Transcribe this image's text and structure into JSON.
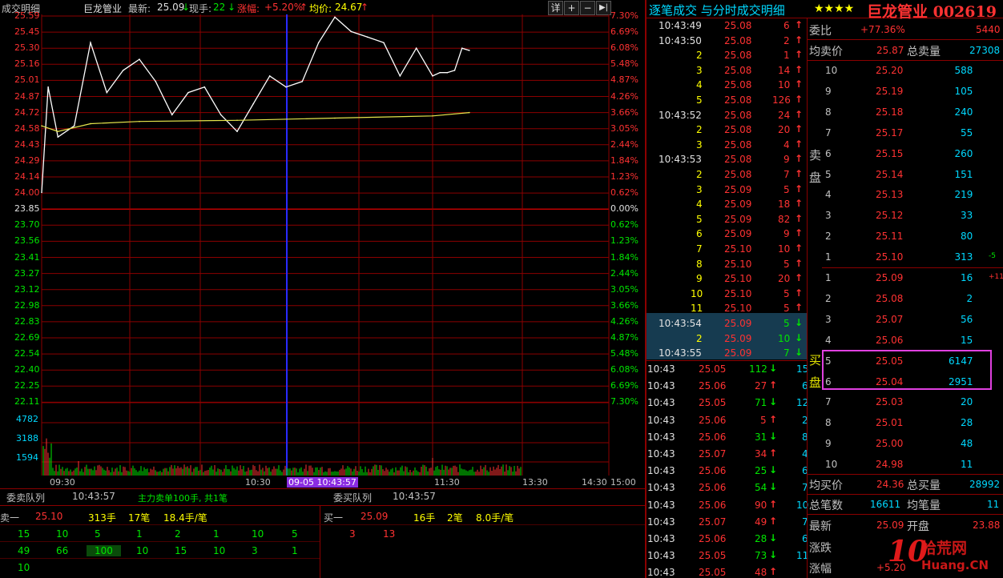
{
  "header": {
    "panel_name": "成交明细",
    "stock_name": "巨龙管业",
    "latest_label": "最新:",
    "latest_value": "25.09",
    "current_hand_label": "现手:",
    "current_hand_value": "22",
    "change_label": "涨幅:",
    "change_value": "+5.20%",
    "avg_label": "均价:",
    "avg_value": "24.67",
    "detail_button": "详",
    "plus_button": "+",
    "minus_button": "−",
    "next_button": "▶|"
  },
  "chart": {
    "left_prices": [
      "25.59",
      "25.45",
      "25.30",
      "25.16",
      "25.01",
      "24.87",
      "24.72",
      "24.58",
      "24.43",
      "24.29",
      "24.14",
      "24.00",
      "23.85",
      "23.70",
      "23.56",
      "23.41",
      "23.27",
      "23.12",
      "22.98",
      "22.83",
      "22.69",
      "22.54",
      "22.40",
      "22.25",
      "22.11"
    ],
    "right_pcts": [
      "7.30%",
      "6.69%",
      "6.08%",
      "5.48%",
      "4.87%",
      "4.26%",
      "3.66%",
      "3.05%",
      "2.44%",
      "1.84%",
      "1.23%",
      "0.62%",
      "0.00%",
      "0.62%",
      "1.23%",
      "1.84%",
      "2.44%",
      "3.05%",
      "3.66%",
      "4.26%",
      "4.87%",
      "5.48%",
      "6.08%",
      "6.69%",
      "7.30%"
    ],
    "volume_ticks": [
      "4782",
      "3188",
      "1594"
    ],
    "time_labels": [
      "09:30",
      "10:30",
      "11:30",
      "13:30",
      "14:30",
      "15:00"
    ],
    "cursor_label": "09-05 10:43:57",
    "colors": {
      "up": "#ff3232",
      "down": "#00e600",
      "price_line": "#ffffff",
      "avg_line": "#e6e64c",
      "grid": "#8b0000",
      "cursor": "#2a2aff"
    }
  },
  "chart_data": {
    "type": "line",
    "title": "",
    "xlabel": "",
    "ylabel": "",
    "ylim": [
      22.11,
      25.59
    ],
    "prev_close": 23.85,
    "series": [
      {
        "name": "",
        "x": [
          "09:30",
          "09:32",
          "09:35",
          "09:40",
          "09:45",
          "09:50",
          "09:55",
          "10:00",
          "10:05",
          "10:10",
          "10:15",
          "10:20",
          "10:25",
          "10:30",
          "10:35",
          "10:40",
          "10:45",
          "10:50",
          "10:55",
          "11:00",
          "11:05",
          "11:10",
          "11:15",
          "11:20",
          "11:25",
          "11:30",
          "13:05",
          "13:10",
          "13:15",
          "13:20",
          "13:25"
        ],
        "values": [
          24.0,
          24.95,
          24.5,
          24.6,
          25.35,
          24.9,
          25.1,
          25.2,
          25.0,
          24.7,
          24.9,
          24.95,
          24.7,
          24.55,
          24.8,
          25.05,
          24.95,
          25.0,
          25.35,
          25.58,
          25.45,
          25.4,
          25.35,
          25.05,
          25.3,
          25.05,
          25.08,
          25.08,
          25.1,
          25.3,
          25.28
        ]
      },
      {
        "name": "",
        "x": [
          "09:30",
          "09:35",
          "09:45",
          "10:00",
          "10:30",
          "11:00",
          "11:30",
          "13:25"
        ],
        "values": [
          24.6,
          24.55,
          24.62,
          24.64,
          24.65,
          24.67,
          24.69,
          24.72
        ]
      }
    ]
  },
  "bottom_left": {
    "queue_label": "委卖队列",
    "queue_time": "10:43:57",
    "note": "主力卖单100手, 共1笔",
    "sell1_label": "卖一",
    "sell1_price": "25.10",
    "sell1_vol": "313手",
    "sell1_count": "17笔",
    "sell1_avg": "18.4手/笔",
    "row1": [
      "15",
      "10",
      "5",
      "1",
      "2",
      "1",
      "10",
      "5"
    ],
    "row2": [
      "49",
      "66",
      "100",
      "10",
      "15",
      "10",
      "3",
      "1"
    ],
    "row3": [
      "10"
    ]
  },
  "bottom_mid": {
    "queue_label": "委买队列",
    "queue_time": "10:43:57",
    "buy1_label": "买一",
    "buy1_price": "25.09",
    "buy1_vol": "16手",
    "buy1_count": "2笔",
    "buy1_avg": "8.0手/笔",
    "row1": [
      "3",
      "13"
    ]
  },
  "ticks_panel": {
    "title": "逐笔成交 与分时成交明细",
    "rows": [
      {
        "t": "10:43:49",
        "p": "25.08",
        "v": "6",
        "d": "up"
      },
      {
        "t": "10:43:50",
        "p": "25.08",
        "v": "2",
        "d": "up"
      },
      {
        "t": "2",
        "p": "25.08",
        "v": "1",
        "d": "up"
      },
      {
        "t": "3",
        "p": "25.08",
        "v": "14",
        "d": "up"
      },
      {
        "t": "4",
        "p": "25.08",
        "v": "10",
        "d": "up"
      },
      {
        "t": "5",
        "p": "25.08",
        "v": "126",
        "d": "up"
      },
      {
        "t": "10:43:52",
        "p": "25.08",
        "v": "24",
        "d": "up"
      },
      {
        "t": "2",
        "p": "25.08",
        "v": "20",
        "d": "up"
      },
      {
        "t": "3",
        "p": "25.08",
        "v": "4",
        "d": "up"
      },
      {
        "t": "10:43:53",
        "p": "25.08",
        "v": "9",
        "d": "up"
      },
      {
        "t": "2",
        "p": "25.08",
        "v": "7",
        "d": "up"
      },
      {
        "t": "3",
        "p": "25.09",
        "v": "5",
        "d": "up"
      },
      {
        "t": "4",
        "p": "25.09",
        "v": "18",
        "d": "up"
      },
      {
        "t": "5",
        "p": "25.09",
        "v": "82",
        "d": "up"
      },
      {
        "t": "6",
        "p": "25.09",
        "v": "9",
        "d": "up"
      },
      {
        "t": "7",
        "p": "25.10",
        "v": "10",
        "d": "up"
      },
      {
        "t": "8",
        "p": "25.10",
        "v": "5",
        "d": "up"
      },
      {
        "t": "9",
        "p": "25.10",
        "v": "20",
        "d": "up"
      },
      {
        "t": "10",
        "p": "25.10",
        "v": "5",
        "d": "up"
      },
      {
        "t": "11",
        "p": "25.10",
        "v": "5",
        "d": "up"
      },
      {
        "t": "10:43:54",
        "p": "25.09",
        "v": "5",
        "d": "down"
      },
      {
        "t": "2",
        "p": "25.09",
        "v": "10",
        "d": "down"
      },
      {
        "t": "10:43:55",
        "p": "25.09",
        "v": "7",
        "d": "down"
      }
    ],
    "minute_rows": [
      {
        "t": "10:43",
        "p": "25.05",
        "v": "112",
        "d": "down",
        "n": "15"
      },
      {
        "t": "10:43",
        "p": "25.06",
        "v": "27",
        "d": "up",
        "n": "6"
      },
      {
        "t": "10:43",
        "p": "25.05",
        "v": "71",
        "d": "down",
        "n": "12"
      },
      {
        "t": "10:43",
        "p": "25.06",
        "v": "5",
        "d": "up",
        "n": "2"
      },
      {
        "t": "10:43",
        "p": "25.06",
        "v": "31",
        "d": "down",
        "n": "8"
      },
      {
        "t": "10:43",
        "p": "25.07",
        "v": "34",
        "d": "up",
        "n": "4"
      },
      {
        "t": "10:43",
        "p": "25.06",
        "v": "25",
        "d": "down",
        "n": "6"
      },
      {
        "t": "10:43",
        "p": "25.06",
        "v": "54",
        "d": "down",
        "n": "7"
      },
      {
        "t": "10:43",
        "p": "25.06",
        "v": "90",
        "d": "up",
        "n": "10"
      },
      {
        "t": "10:43",
        "p": "25.07",
        "v": "49",
        "d": "up",
        "n": "7"
      },
      {
        "t": "10:43",
        "p": "25.06",
        "v": "28",
        "d": "down",
        "n": "6"
      },
      {
        "t": "10:43",
        "p": "25.05",
        "v": "73",
        "d": "down",
        "n": "11"
      },
      {
        "t": "10:43",
        "p": "25.05",
        "v": "48",
        "d": "up",
        "n": ""
      }
    ]
  },
  "quote_panel": {
    "stars": "★★★★",
    "stock_title": "巨龙管业 002619",
    "weibi_label": "委比",
    "weibi_pct": "+77.36%",
    "weibi_val": "5440",
    "avg_sell_label": "均卖价",
    "avg_sell": "25.87",
    "total_sell_label": "总卖量",
    "total_sell": "27308",
    "sell_side_label": "卖盘",
    "buy_side_label": "买盘",
    "asks": [
      {
        "lvl": "10",
        "p": "25.20",
        "v": "588",
        "chg": ""
      },
      {
        "lvl": "9",
        "p": "25.19",
        "v": "105",
        "chg": ""
      },
      {
        "lvl": "8",
        "p": "25.18",
        "v": "240",
        "chg": ""
      },
      {
        "lvl": "7",
        "p": "25.17",
        "v": "55",
        "chg": ""
      },
      {
        "lvl": "6",
        "p": "25.15",
        "v": "260",
        "chg": ""
      },
      {
        "lvl": "5",
        "p": "25.14",
        "v": "151",
        "chg": ""
      },
      {
        "lvl": "4",
        "p": "25.13",
        "v": "219",
        "chg": ""
      },
      {
        "lvl": "3",
        "p": "25.12",
        "v": "33",
        "chg": ""
      },
      {
        "lvl": "2",
        "p": "25.11",
        "v": "80",
        "chg": ""
      },
      {
        "lvl": "1",
        "p": "25.10",
        "v": "313",
        "chg": "-5"
      }
    ],
    "bids": [
      {
        "lvl": "1",
        "p": "25.09",
        "v": "16",
        "chg": "+11"
      },
      {
        "lvl": "2",
        "p": "25.08",
        "v": "2",
        "chg": ""
      },
      {
        "lvl": "3",
        "p": "25.07",
        "v": "56",
        "chg": ""
      },
      {
        "lvl": "4",
        "p": "25.06",
        "v": "15",
        "chg": ""
      },
      {
        "lvl": "5",
        "p": "25.05",
        "v": "6147",
        "chg": ""
      },
      {
        "lvl": "6",
        "p": "25.04",
        "v": "2951",
        "chg": ""
      },
      {
        "lvl": "7",
        "p": "25.03",
        "v": "20",
        "chg": ""
      },
      {
        "lvl": "8",
        "p": "25.01",
        "v": "28",
        "chg": ""
      },
      {
        "lvl": "9",
        "p": "25.00",
        "v": "48",
        "chg": ""
      },
      {
        "lvl": "10",
        "p": "24.98",
        "v": "11",
        "chg": ""
      }
    ],
    "avg_buy_label": "均买价",
    "avg_buy": "24.36",
    "total_buy_label": "总买量",
    "total_buy": "28992",
    "total_trades_label": "总笔数",
    "total_trades": "16611",
    "avg_per_trade_label": "均笔量",
    "avg_per_trade": "11",
    "latest_label": "最新",
    "latest": "25.09",
    "open_label": "开盘",
    "open": "23.88",
    "change_label": "涨跌",
    "change_pct_label": "涨幅",
    "change_pct": "+5.20"
  },
  "watermark": {
    "logo_num": "10",
    "logo_text": "拾荒网",
    "url": "Huang.CN"
  }
}
